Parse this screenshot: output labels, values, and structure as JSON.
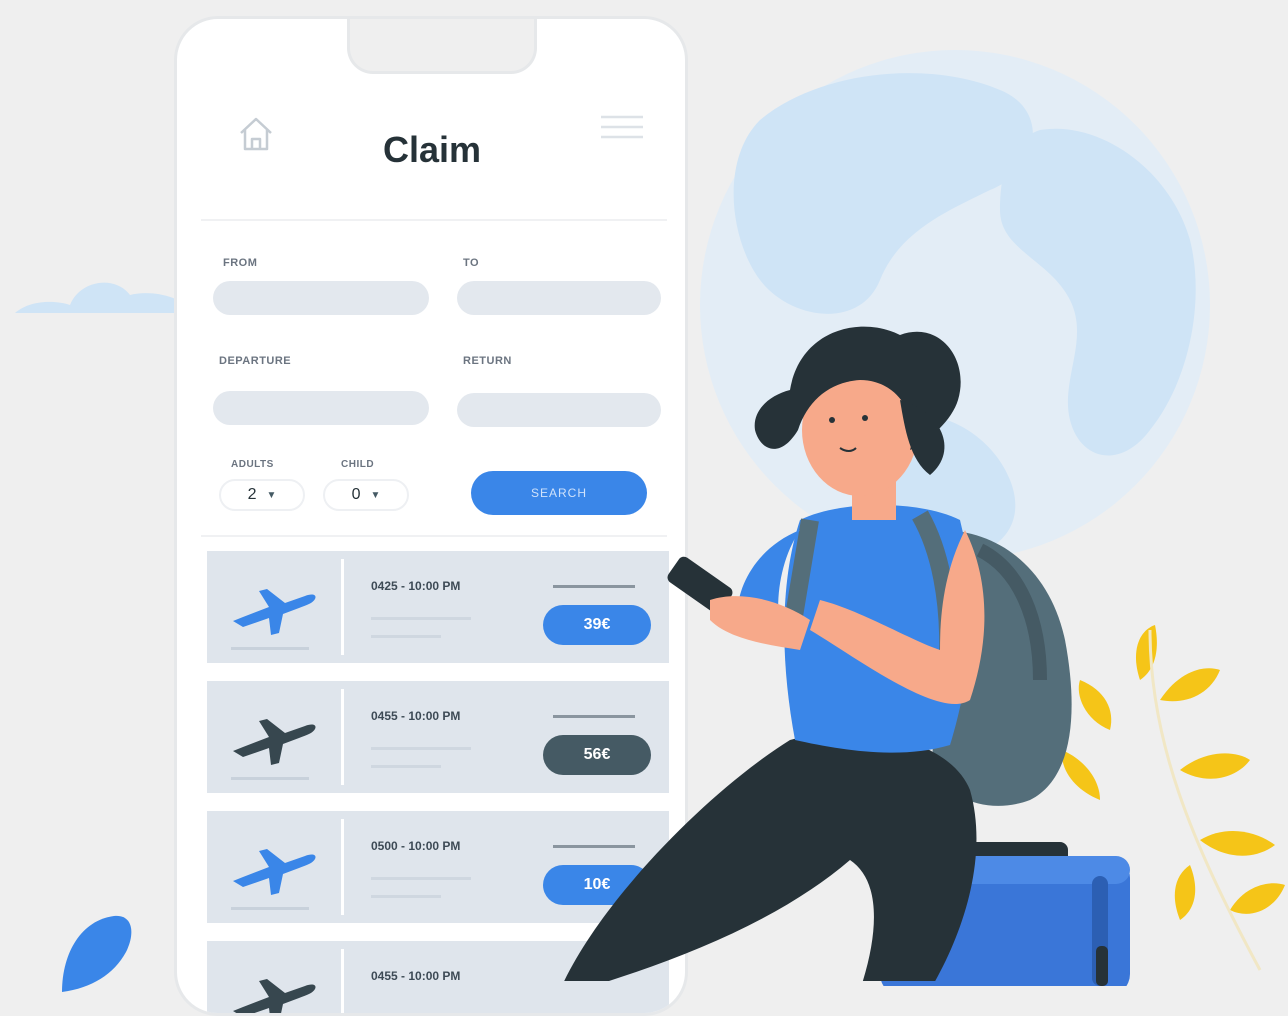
{
  "app": {
    "title": "Claim"
  },
  "form": {
    "from_label": "FROM",
    "to_label": "TO",
    "departure_label": "DEPARTURE",
    "return_label": "RETURN",
    "adults_label": "ADULTS",
    "child_label": "CHILD",
    "adults_value": "2",
    "child_value": "0",
    "search_label": "SEARCH"
  },
  "flights": [
    {
      "times": "0425 - 10:00 PM",
      "price": "39€",
      "plane_color": "#3a86e8",
      "price_color": "#3a86e8"
    },
    {
      "times": "0455 - 10:00 PM",
      "price": "56€",
      "plane_color": "#37474f",
      "price_color": "#455a64"
    },
    {
      "times": "0500 - 10:00 PM",
      "price": "10€",
      "plane_color": "#3a86e8",
      "price_color": "#3a86e8"
    },
    {
      "times": "0455 - 10:00 PM",
      "price": "",
      "plane_color": "#37474f",
      "price_color": "#455a64"
    }
  ],
  "colors": {
    "accent": "#3a86e8",
    "dark": "#263238",
    "leaf": "#f5c518",
    "globe": "#cfe4f6"
  }
}
